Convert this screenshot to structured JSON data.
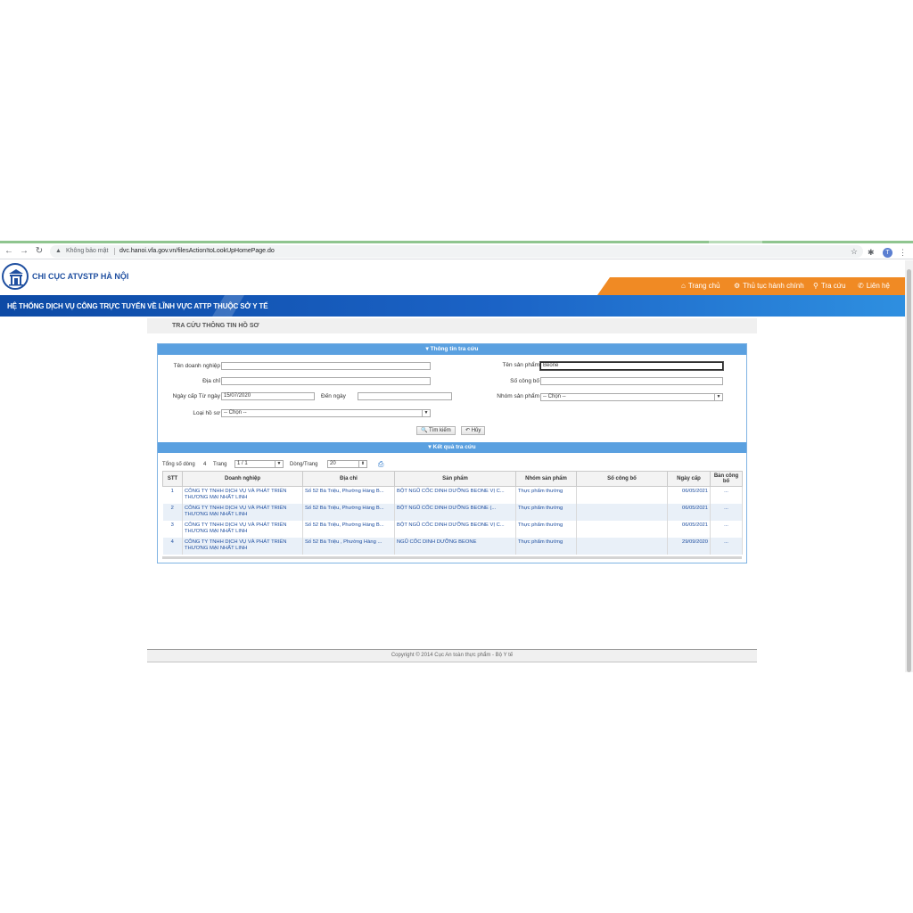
{
  "browser": {
    "security_label": "Không bảo mật",
    "url": "dvc.hanoi.vfa.gov.vn/filesAction!toLookUpHomePage.do",
    "profile_initial": "T"
  },
  "header": {
    "org_name": "CHI CỤC ATVSTP HÀ NỘI",
    "system_title": "HỆ THỐNG DỊCH VỤ CÔNG TRỰC TUYẾN VỀ LĨNH VỰC ATTP THUỘC SỞ Y TẾ",
    "nav": [
      "Trang chủ",
      "Thủ tục hành chính",
      "Tra cứu",
      "Liên hệ"
    ]
  },
  "page": {
    "title": "TRA CỨU THÔNG TIN HỒ SƠ"
  },
  "search": {
    "section_title": "Thông tin tra cứu",
    "labels": {
      "company": "Tên doanh nghiệp",
      "address": "Địa chỉ",
      "from_date": "Ngày cấp Từ ngày",
      "to_date": "Đến ngày",
      "file_type": "Loại hồ sơ",
      "product_name": "Tên sản phẩm",
      "declaration_no": "Số công bố",
      "product_group": "Nhóm sản phẩm"
    },
    "values": {
      "company": "",
      "address": "",
      "from_date": "15/07/2020",
      "to_date": "",
      "file_type": "-- Chọn --",
      "product_name": "Beone",
      "declaration_no": "",
      "product_group": "-- Chọn --"
    },
    "search_button": "Tìm kiếm",
    "cancel_button": "Hủy"
  },
  "results": {
    "section_title": "Kết quả tra cứu",
    "total_label": "Tổng số dòng",
    "total_value": "4",
    "page_label": "Trang",
    "page_value": "1 / 1",
    "rows_label": "Dòng/Trang",
    "rows_value": "20",
    "columns": [
      "STT",
      "Doanh nghiệp",
      "Địa chỉ",
      "Sản phẩm",
      "Nhóm sản phẩm",
      "Số công bố",
      "Ngày cấp",
      "Bản công bố"
    ],
    "rows": [
      {
        "stt": "1",
        "company": "CÔNG TY TNHH DỊCH VỤ VÀ PHÁT TRIỂN THƯƠNG MẠI NHẤT LINH",
        "address": "Số 52 Bà Triệu, Phường Hàng B...",
        "product": "BỘT NGŨ CỐC DINH DƯỠNG BEONE VỊ C...",
        "group": "Thực phẩm thường",
        "decl_no": "",
        "date": "06/05/2021",
        "doc": "..."
      },
      {
        "stt": "2",
        "company": "CÔNG TY TNHH DỊCH VỤ VÀ PHÁT TRIỂN THƯƠNG MẠI NHẤT LINH",
        "address": "Số 52 Bà Triệu, Phường Hàng B...",
        "product": "BỘT NGŨ CỐC DINH DƯỠNG BEONE (...",
        "group": "Thực phẩm thường",
        "decl_no": "",
        "date": "06/05/2021",
        "doc": "..."
      },
      {
        "stt": "3",
        "company": "CÔNG TY TNHH DỊCH VỤ VÀ PHÁT TRIỂN THƯƠNG MẠI NHẤT LINH",
        "address": "Số 52 Bà Triệu, Phường Hàng B...",
        "product": "BỘT NGŨ CỐC DINH DƯỠNG BEONE VỊ C...",
        "group": "Thực phẩm thường",
        "decl_no": "",
        "date": "06/05/2021",
        "doc": "..."
      },
      {
        "stt": "4",
        "company": "CÔNG TY TNHH DỊCH VỤ VÀ PHÁT TRIỂN THƯƠNG MẠI NHẤT LINH",
        "address": "Số 52 Bà Triệu , Phường Hàng ...",
        "product": "NGŨ CỐC DINH DƯỠNG BEONE",
        "group": "Thực phẩm thường",
        "decl_no": "",
        "date": "29/09/2020",
        "doc": "..."
      }
    ]
  },
  "footer": {
    "copyright": "Copyright © 2014 Cục An toàn thực phẩm - Bộ Y tế"
  },
  "icons": {
    "back": "back-arrow-icon",
    "forward": "forward-arrow-icon",
    "reload": "reload-icon",
    "warning": "warning-icon",
    "star": "star-icon",
    "extensions": "puzzle-icon",
    "menu": "kebab-menu-icon",
    "home": "home-icon",
    "procedures": "gear-icon",
    "lookup": "search-icon",
    "contact": "phone-icon"
  },
  "colors": {
    "brand_blue": "#1f4fa0",
    "nav_orange": "#f08a24",
    "panel_header": "#5aa0e0"
  }
}
